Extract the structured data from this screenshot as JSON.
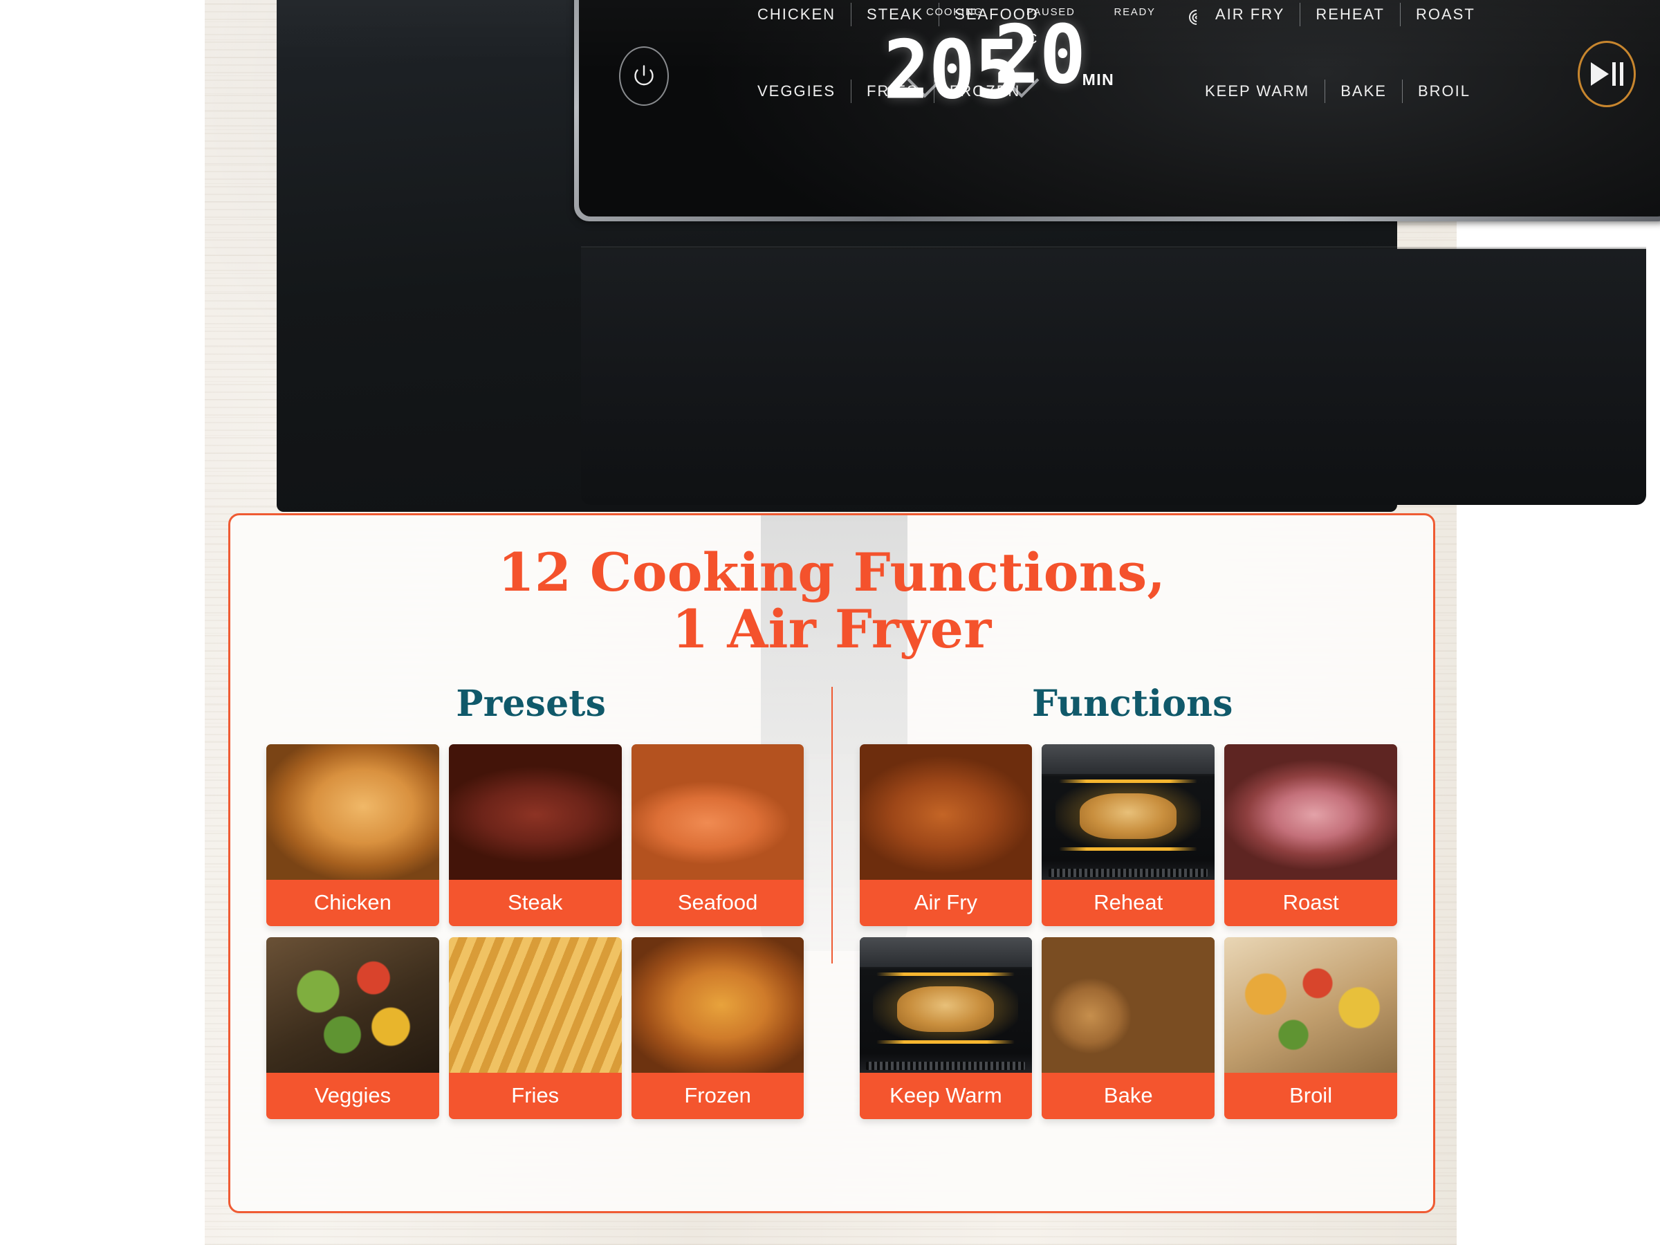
{
  "appliance": {
    "control_panel": {
      "power_button": {
        "icon": "power-icon",
        "label": "Power"
      },
      "play_pause_button": {
        "icon": "play-pause-icon",
        "label": "Start/Pause",
        "ring_color": "#c8862e"
      },
      "presets_top": [
        "CHICKEN",
        "STEAK",
        "SEAFOOD"
      ],
      "presets_bottom": [
        "VEGGIES",
        "FRIES",
        "FROZEN"
      ],
      "functions_top": [
        "AIR FRY",
        "REHEAT",
        "ROAST"
      ],
      "functions_bottom": [
        "KEEP WARM",
        "BAKE",
        "BROIL"
      ],
      "status_indicators": [
        "COOKING",
        "PAUSED",
        "READY"
      ],
      "wifi_icon": "wifi-icon",
      "temperature": {
        "value": "205",
        "unit": "°C",
        "up_icon": "chevron-up-icon",
        "down_icon": "chevron-down-icon"
      },
      "timer": {
        "value": "20",
        "unit": "MIN",
        "up_icon": "chevron-up-icon",
        "down_icon": "chevron-down-icon"
      }
    }
  },
  "card": {
    "headline_line1": "12 Cooking Functions,",
    "headline_line2": "1 Air Fryer",
    "accent_color": "#f4522c",
    "title_color": "#10596a",
    "presets": {
      "title": "Presets",
      "items": [
        {
          "label": "Chicken",
          "image": "roast-chicken-photo"
        },
        {
          "label": "Steak",
          "image": "sliced-steak-photo"
        },
        {
          "label": "Seafood",
          "image": "salmon-fillet-photo"
        },
        {
          "label": "Veggies",
          "image": "roasted-vegetables-photo"
        },
        {
          "label": "Fries",
          "image": "french-fries-photo"
        },
        {
          "label": "Frozen",
          "image": "frozen-pizza-photo"
        }
      ]
    },
    "functions": {
      "title": "Functions",
      "items": [
        {
          "label": "Air Fry",
          "image": "air-fried-chicken-photo"
        },
        {
          "label": "Reheat",
          "image": "oven-interior-pastry-photo"
        },
        {
          "label": "Roast",
          "image": "roast-beef-photo"
        },
        {
          "label": "Keep Warm",
          "image": "oven-interior-bread-photo"
        },
        {
          "label": "Bake",
          "image": "muffins-photo"
        },
        {
          "label": "Broil",
          "image": "broiled-toast-photo"
        }
      ]
    }
  }
}
